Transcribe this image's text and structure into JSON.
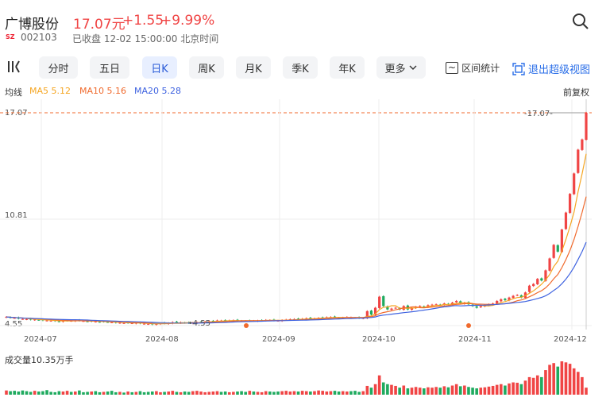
{
  "header": {
    "name": "广博股份",
    "price": "17.07元",
    "change": "+1.55",
    "change_pct": "+9.99%",
    "market_badge": "SZ",
    "code": "002103",
    "status": "已收盘 12-02 15:00:00 北京时间",
    "up_color": "#f04545",
    "search_icon": "search-icon"
  },
  "toolbar": {
    "kline_icon": "candlestick-icon",
    "tabs": [
      "分时",
      "五日",
      "日K",
      "周K",
      "月K",
      "季K",
      "年K",
      "更多"
    ],
    "active_tab": "日K",
    "range_stats": "区间统计",
    "exit_fullscreen": "退出超级视图"
  },
  "ma": {
    "label": "均线",
    "ma5": "MA5 5.12",
    "ma10": "MA10 5.16",
    "ma20": "MA20 5.28",
    "ma5_color": "#f5a623",
    "ma10_color": "#f06a2d",
    "ma20_color": "#3f63e0",
    "adjust": "前复权"
  },
  "chart_data": {
    "type": "candlestick",
    "y_labels": [
      "17.07",
      "10.81",
      "4.55"
    ],
    "x_labels": [
      "2024-07",
      "2024-08",
      "2024-09",
      "2024-10",
      "2024-11",
      "2024-12"
    ],
    "high_marker": "17.07",
    "low_marker": "4.55",
    "volume_label": "成交量10.35万手",
    "up_color": "#f04545",
    "down_color": "#1faa5f",
    "closes": [
      5.06,
      5.02,
      5.0,
      4.96,
      4.94,
      4.93,
      4.9,
      4.91,
      4.88,
      4.86,
      4.85,
      4.84,
      4.82,
      4.8,
      4.82,
      4.84,
      4.83,
      4.85,
      4.84,
      4.82,
      4.8,
      4.8,
      4.79,
      4.77,
      4.78,
      4.76,
      4.74,
      4.72,
      4.72,
      4.7,
      4.71,
      4.69,
      4.71,
      4.68,
      4.66,
      4.65,
      4.62,
      4.66,
      4.69,
      4.67,
      4.7,
      4.75,
      4.72,
      4.74,
      4.71,
      4.7,
      4.72,
      4.74,
      4.76,
      4.78,
      4.8,
      4.82,
      4.85,
      4.84,
      4.82,
      4.85,
      4.86,
      4.84,
      4.83,
      4.82,
      4.85,
      4.83,
      4.84,
      4.86,
      4.88,
      4.87,
      4.85,
      4.84,
      4.87,
      4.9,
      4.92,
      4.93,
      4.92,
      4.95,
      4.98,
      4.96,
      4.97,
      5.0,
      5.02,
      5.04,
      5.05,
      5.03,
      5.01,
      5.02,
      5.05,
      5.03,
      5.01,
      4.99,
      5.0,
      5.4,
      5.2,
      5.6,
      6.25,
      5.7,
      5.5,
      5.55,
      5.6,
      5.5,
      5.7,
      5.5,
      5.6,
      5.65,
      5.7,
      5.65,
      5.75,
      5.78,
      5.8,
      5.75,
      5.85,
      5.8,
      5.9,
      6.0,
      5.85,
      5.9,
      5.8,
      5.7,
      5.6,
      5.7,
      5.75,
      5.8,
      5.85,
      6.0,
      6.1,
      6.05,
      6.2,
      6.3,
      6.35,
      6.2,
      6.5,
      6.9,
      7.0,
      7.3,
      7.2,
      7.8,
      8.5,
      9.3,
      8.9,
      10.2,
      11.2,
      12.3,
      13.5,
      14.9,
      15.5,
      17.07
    ],
    "volumes": [
      1.2,
      1.0,
      1.1,
      0.9,
      1.2,
      1.0,
      0.8,
      1.1,
      0.9,
      1.0,
      1.3,
      0.8,
      0.7,
      1.0,
      0.9,
      1.1,
      0.8,
      0.9,
      1.2,
      0.7,
      0.8,
      0.9,
      1.0,
      0.7,
      0.8,
      0.9,
      1.1,
      0.7,
      0.8,
      0.6,
      0.9,
      0.7,
      0.8,
      1.0,
      0.7,
      0.8,
      0.9,
      1.0,
      0.7,
      0.8,
      0.9,
      1.1,
      0.8,
      0.7,
      0.9,
      0.8,
      1.0,
      1.1,
      0.9,
      0.7,
      0.8,
      0.9,
      1.0,
      0.8,
      0.9,
      0.7,
      0.8,
      0.9,
      1.0,
      0.8,
      1.1,
      0.9,
      0.8,
      0.7,
      1.0,
      0.9,
      0.8,
      0.9,
      1.0,
      1.1,
      0.9,
      1.0,
      0.9,
      1.1,
      1.0,
      0.9,
      1.0,
      1.2,
      1.1,
      0.9,
      1.0,
      1.1,
      0.9,
      1.0,
      0.9,
      1.0,
      1.1,
      0.8,
      1.0,
      2.5,
      2.0,
      3.0,
      5.5,
      3.5,
      3.0,
      2.8,
      2.5,
      2.0,
      2.6,
      1.8,
      2.0,
      2.2,
      2.0,
      1.8,
      2.1,
      2.0,
      2.2,
      2.0,
      2.4,
      2.1,
      2.6,
      3.0,
      2.4,
      2.6,
      2.2,
      2.0,
      1.8,
      2.0,
      2.1,
      2.3,
      2.5,
      2.8,
      3.0,
      2.6,
      3.2,
      3.5,
      3.4,
      3.0,
      4.0,
      5.0,
      4.8,
      5.5,
      5.0,
      7.0,
      8.5,
      9.0,
      8.0,
      9.5,
      9.2,
      8.8,
      7.5,
      6.5,
      5.0,
      2.0
    ],
    "dots": [
      "2024-09",
      "2024-11"
    ]
  }
}
